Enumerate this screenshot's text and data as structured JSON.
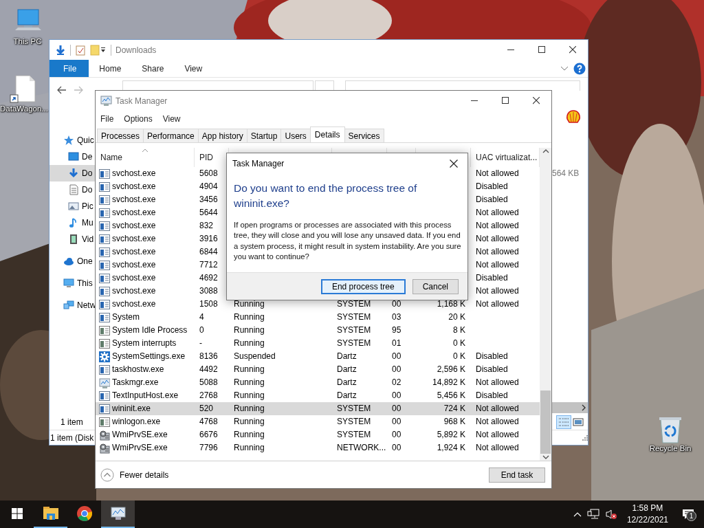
{
  "desktop_icons": [
    {
      "label": "This PC",
      "kind": "pc"
    },
    {
      "label": "DataWagon...",
      "kind": "file"
    },
    {
      "label": "Recycle Bin",
      "kind": "recycle"
    }
  ],
  "explorer": {
    "title": "Downloads",
    "ribbon_tabs": [
      {
        "label": "File",
        "selected": true
      },
      {
        "label": "Home",
        "selected": false
      },
      {
        "label": "Share",
        "selected": false
      },
      {
        "label": "View",
        "selected": false
      }
    ],
    "nav_items": [
      {
        "label": "Quic",
        "kind": "star",
        "selected": false,
        "children": [
          {
            "label": "De",
            "kind": "desktop",
            "selected": false
          },
          {
            "label": "Do",
            "kind": "download",
            "selected": true
          },
          {
            "label": "Do",
            "kind": "document",
            "selected": false
          },
          {
            "label": "Pic",
            "kind": "pictures",
            "selected": false
          },
          {
            "label": "Mu",
            "kind": "music",
            "selected": false
          },
          {
            "label": "Vid",
            "kind": "video",
            "selected": false
          }
        ]
      },
      {
        "label": "One",
        "kind": "cloud",
        "selected": false
      },
      {
        "label": "This",
        "kind": "pc",
        "selected": false
      },
      {
        "label": "Netw",
        "kind": "network",
        "selected": false
      }
    ],
    "file_size": "564 KB",
    "status": "1 item",
    "status_2": "1 item (Disk"
  },
  "task_manager": {
    "title": "Task Manager",
    "menu": [
      "File",
      "Options",
      "View"
    ],
    "tabs": [
      {
        "label": "Processes",
        "selected": false
      },
      {
        "label": "Performance",
        "selected": false
      },
      {
        "label": "App history",
        "selected": false
      },
      {
        "label": "Startup",
        "selected": false
      },
      {
        "label": "Users",
        "selected": false
      },
      {
        "label": "Details",
        "selected": true
      },
      {
        "label": "Services",
        "selected": false
      }
    ],
    "columns": [
      {
        "kind": "name",
        "label": "Name",
        "sorted": true
      },
      {
        "kind": "pid",
        "label": "PID",
        "sorted": false
      },
      {
        "kind": "uac",
        "label": "UAC virtualizat...",
        "sorted": false
      }
    ],
    "rows": [
      {
        "kind": "app",
        "name": "svchost.exe",
        "pid": "5608",
        "uac": "Not allowed",
        "selected": false
      },
      {
        "kind": "app",
        "name": "svchost.exe",
        "pid": "4904",
        "uac": "Disabled",
        "selected": false
      },
      {
        "kind": "app",
        "name": "svchost.exe",
        "pid": "3456",
        "uac": "Disabled",
        "selected": false
      },
      {
        "kind": "app",
        "name": "svchost.exe",
        "pid": "5644",
        "uac": "Not allowed",
        "selected": false
      },
      {
        "kind": "app",
        "name": "svchost.exe",
        "pid": "832",
        "uac": "Not allowed",
        "selected": false
      },
      {
        "kind": "app",
        "name": "svchost.exe",
        "pid": "3916",
        "uac": "Not allowed",
        "selected": false
      },
      {
        "kind": "app",
        "name": "svchost.exe",
        "pid": "6844",
        "uac": "Not allowed",
        "selected": false
      },
      {
        "kind": "app",
        "name": "svchost.exe",
        "pid": "7712",
        "uac": "Not allowed",
        "selected": false
      },
      {
        "kind": "app",
        "name": "svchost.exe",
        "pid": "4692",
        "uac": "Disabled",
        "selected": false
      },
      {
        "kind": "app",
        "name": "svchost.exe",
        "pid": "3088",
        "uac": "Not allowed",
        "selected": false
      },
      {
        "kind": "app",
        "name": "svchost.exe",
        "pid": "1508",
        "status": "Running",
        "user": "SYSTEM",
        "cpu": "00",
        "memory": "1,168 K",
        "uac": "Not allowed",
        "selected": false
      },
      {
        "kind": "app",
        "name": "System",
        "pid": "4",
        "status": "Running",
        "user": "SYSTEM",
        "cpu": "03",
        "memory": "20 K",
        "selected": false
      },
      {
        "kind": "app-gray",
        "name": "System Idle Process",
        "pid": "0",
        "status": "Running",
        "user": "SYSTEM",
        "cpu": "95",
        "memory": "8 K",
        "selected": false
      },
      {
        "kind": "app-gray",
        "name": "System interrupts",
        "pid": "-",
        "status": "Running",
        "user": "SYSTEM",
        "cpu": "01",
        "memory": "0 K",
        "selected": false
      },
      {
        "kind": "gear",
        "name": "SystemSettings.exe",
        "pid": "8136",
        "status": "Suspended",
        "user": "Dartz",
        "cpu": "00",
        "memory": "0 K",
        "uac": "Disabled",
        "selected": false
      },
      {
        "kind": "app",
        "name": "taskhostw.exe",
        "pid": "4492",
        "status": "Running",
        "user": "Dartz",
        "cpu": "00",
        "memory": "2,596 K",
        "uac": "Disabled",
        "selected": false
      },
      {
        "kind": "monitor",
        "name": "Taskmgr.exe",
        "pid": "5088",
        "status": "Running",
        "user": "Dartz",
        "cpu": "02",
        "memory": "14,892 K",
        "uac": "Not allowed",
        "selected": false
      },
      {
        "kind": "app",
        "name": "TextInputHost.exe",
        "pid": "2768",
        "status": "Running",
        "user": "Dartz",
        "cpu": "00",
        "memory": "5,456 K",
        "uac": "Disabled",
        "selected": false
      },
      {
        "kind": "app",
        "name": "wininit.exe",
        "pid": "520",
        "status": "Running",
        "user": "SYSTEM",
        "cpu": "00",
        "memory": "724 K",
        "uac": "Not allowed",
        "selected": true
      },
      {
        "kind": "app-gray",
        "name": "winlogon.exe",
        "pid": "4768",
        "status": "Running",
        "user": "SYSTEM",
        "cpu": "00",
        "memory": "968 K",
        "uac": "Not allowed",
        "selected": false
      },
      {
        "kind": "gears",
        "name": "WmiPrvSE.exe",
        "pid": "6676",
        "status": "Running",
        "user": "SYSTEM",
        "cpu": "00",
        "memory": "5,892 K",
        "uac": "Not allowed",
        "selected": false
      },
      {
        "kind": "gears",
        "name": "WmiPrvSE.exe",
        "pid": "7796",
        "status": "Running",
        "user": "NETWORK...",
        "cpu": "00",
        "memory": "1,924 K",
        "uac": "Not allowed",
        "selected": false
      }
    ],
    "fewer_details": "Fewer details",
    "end_task": "End task"
  },
  "dialog": {
    "title": "Task Manager",
    "heading": "Do you want to end the process tree of wininit.exe?",
    "message": "If open programs or processes are associated with this process tree, they will close and you will lose any unsaved data. If you end a system process, it might result in system instability. Are you sure you want to continue?",
    "buttons": [
      {
        "label": "End process tree",
        "default": true
      },
      {
        "label": "Cancel",
        "default": false
      }
    ]
  },
  "taskbar": {
    "apps": [
      {
        "kind": "explorer",
        "open": true,
        "active": false
      },
      {
        "kind": "chrome",
        "open": false,
        "active": false
      },
      {
        "kind": "taskmgr",
        "open": true,
        "active": true
      }
    ],
    "time": "1:58 PM",
    "date": "12/22/2021",
    "notifications": "1"
  }
}
